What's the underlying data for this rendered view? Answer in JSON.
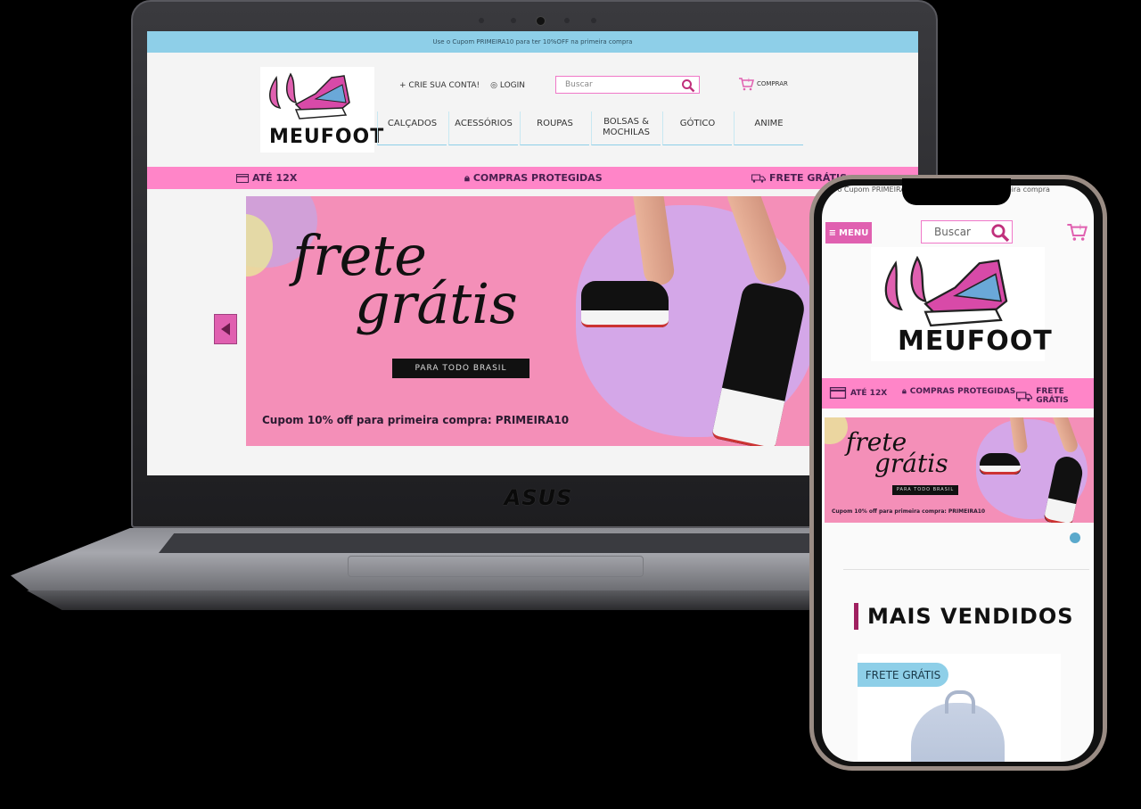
{
  "laptop": {
    "brand": "ASUS",
    "site": {
      "promo_bar": "Use o Cupom PRIMEIRA10 para ter 10%OFF na primeira compra",
      "logo_text": "MEUFOOT",
      "account_links": [
        "CRIE SUA CONTA!",
        "LOGIN"
      ],
      "search_placeholder": "Buscar",
      "cart_label": "COMPRAR",
      "menu": [
        "CALÇADOS",
        "ACESSÓRIOS",
        "ROUPAS",
        "BOLSAS & MOCHILAS",
        "GÓTICO",
        "ANIME"
      ],
      "benefits": [
        "ATÉ 12X",
        "COMPRAS PROTEGIDAS",
        "FRETE GRÁTIS"
      ],
      "banner": {
        "headline_1": "frete",
        "headline_2": "grátis",
        "tagline": "PARA TODO BRASIL",
        "coupon_text": "Cupom 10% off para primeira compra: PRIMEIRA10"
      }
    }
  },
  "phone": {
    "site": {
      "promo_ticker": "Use o Cupom PRIMEIRA10 para ter 10%OFF na primeira compra",
      "menu_label": "MENU",
      "search_placeholder": "Buscar",
      "logo_text": "MEUFOOT",
      "benefits": [
        "ATÉ 12X",
        "COMPRAS PROTEGIDAS",
        "FRETE GRÁTIS"
      ],
      "banner": {
        "headline_1": "frete",
        "headline_2": "grátis",
        "tagline": "PARA TODO BRASIL",
        "coupon_text": "Cupom 10% off para primeira compra: PRIMEIRA10"
      },
      "section_title": "MAIS VENDIDOS",
      "product_badge": "FRETE GRÁTIS"
    }
  },
  "colors": {
    "pink_bar": "#ff85c8",
    "blue_bar": "#8ecfe8",
    "accent_magenta": "#e060b0",
    "banner_pink": "#f48fb8"
  }
}
